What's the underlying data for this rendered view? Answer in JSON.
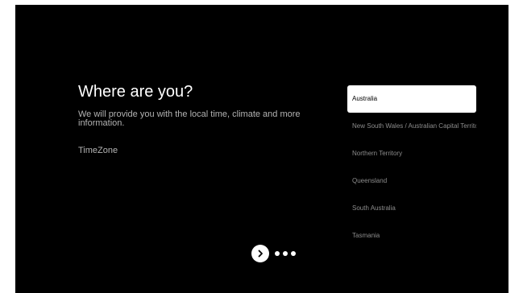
{
  "screen": {
    "title": "Where are you?",
    "subtitle": "We will provide you with the local time, climate and more information.",
    "timezone_label": "TimeZone"
  },
  "regions": {
    "selected_index": 0,
    "items": [
      {
        "label": "Australia"
      },
      {
        "label": "New South Wales / Australian Capital Territory"
      },
      {
        "label": "Northern Territory"
      },
      {
        "label": "Queensland"
      },
      {
        "label": "South Australia"
      },
      {
        "label": "Tasmania"
      }
    ]
  },
  "pager": {
    "next_icon": "chevron-right-icon",
    "dots": 3
  },
  "colors": {
    "background": "#000000",
    "primary_text": "#ffffff",
    "secondary_text": "#b3b3b3",
    "list_text": "#8c8c8c",
    "selected_bg": "#ffffff"
  }
}
